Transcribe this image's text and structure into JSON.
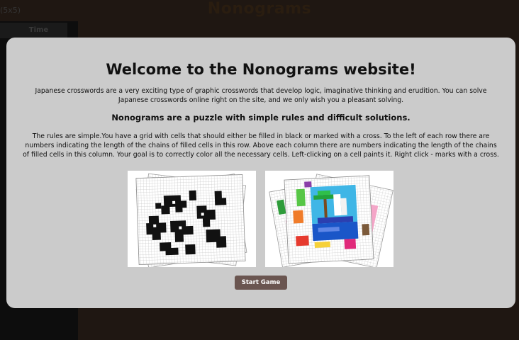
{
  "background": {
    "page_title": "Nonograms",
    "size_label": "(5x5)",
    "time_header": "Time"
  },
  "modal": {
    "title": "Welcome to the Nonograms website!",
    "intro": "Japanese crosswords are a very exciting type of graphic crosswords that develop logic, imaginative thinking and erudition. You can solve Japanese crosswords online right on the site, and we only wish you a pleasant solving.",
    "subheading": "Nonograms are a puzzle with simple rules and difficult solutions.",
    "rules": "The rules are simple.You have a grid with cells that should either be filled in black or marked with a cross. To the left of each row there are numbers indicating the length of the chains of filled cells in this row. Above each column there are numbers indicating the length of the chains of filled cells in this column. Your goal is to correctly color all the necessary cells. Left-clicking on a cell paints it. Right click - marks with a cross.",
    "start_button": "Start Game"
  },
  "colors": {
    "page_background": "#1f1712",
    "modal_background": "#cbcbcb",
    "button_background": "#6a5550"
  }
}
